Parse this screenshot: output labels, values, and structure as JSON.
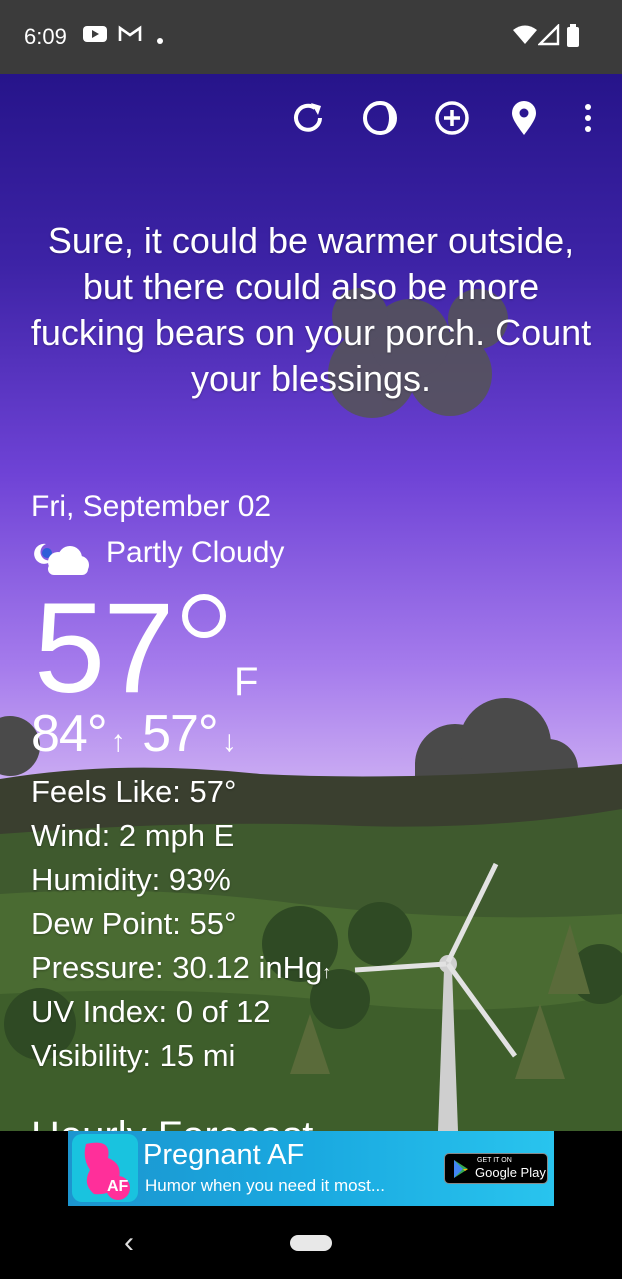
{
  "status_bar": {
    "time": "6:09",
    "icons": [
      "youtube-icon",
      "gmail-icon",
      "dot-icon",
      "wifi-icon",
      "signal-icon",
      "battery-icon"
    ]
  },
  "toolbar": {
    "icons": [
      "refresh-icon",
      "moon-phase-icon",
      "add-location-icon",
      "location-pin-icon",
      "more-vert-icon"
    ]
  },
  "quote": "Sure, it could be warmer outside, but there could also be more fucking bears on your porch. Count your blessings.",
  "weather": {
    "date": "Fri, September 02",
    "condition": "Partly Cloudy",
    "condition_icon": "partly-cloudy-night-icon",
    "temperature": "57",
    "unit": "F",
    "high": "84°",
    "low": "57°",
    "details": [
      "Feels Like:  57°",
      "Wind:  2 mph E",
      "Humidity:  93%",
      "Dew Point:  55°",
      "Pressure:  30.12 inHg",
      "UV Index:  0 of 12",
      "Visibility:  15 mi"
    ]
  },
  "hourly_heading": "Hourly Forecast",
  "ad": {
    "title": "Pregnant AF",
    "subtitle": "Humor when you need it most...",
    "logo_text": "AF",
    "badge_small": "GET IT ON",
    "badge_big": "Google Play"
  },
  "colors": {
    "sky_top": "#26148a",
    "sky_bottom": "#c9b1ef",
    "hill": "#3f5a2e",
    "ad_bg": "#1aa9e0"
  }
}
